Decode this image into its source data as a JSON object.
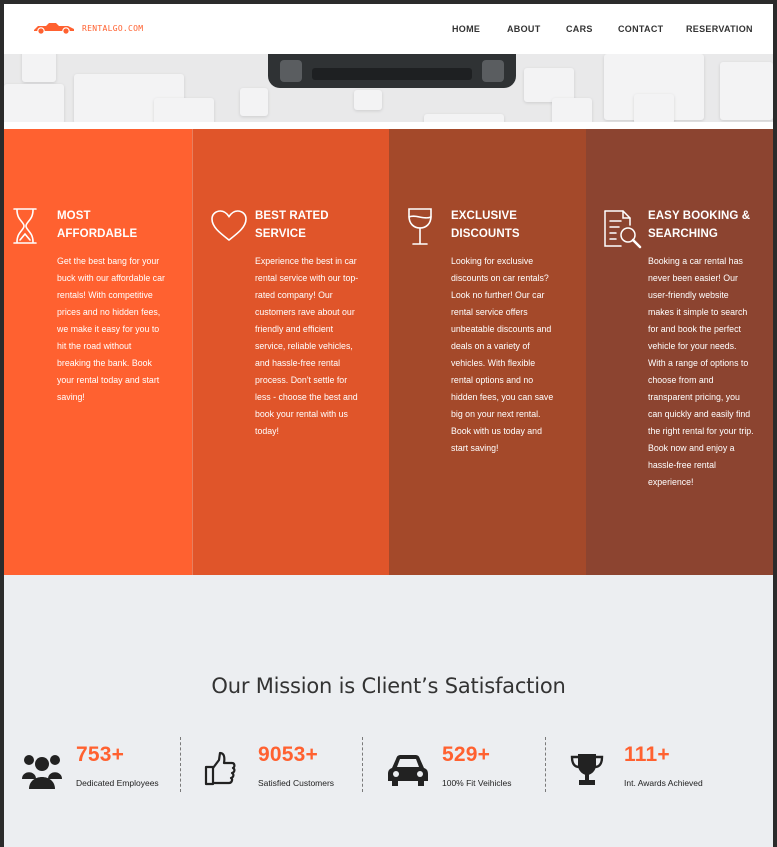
{
  "header": {
    "logo_text": "RENTALGO.COM",
    "nav": [
      "HOME",
      "ABOUT",
      "CARS",
      "CONTACT",
      "RESERVATION"
    ]
  },
  "features": [
    {
      "icon": "hourglass-icon",
      "title_line1": "MOST",
      "title_line2": "AFFORDABLE",
      "text": "Get the best bang for your buck with our affordable car rentals! With competitive prices and no hidden fees, we make it easy for you to hit the road without breaking the bank. Book your rental today and start saving!"
    },
    {
      "icon": "heart-icon",
      "title_line1": "BEST RATED",
      "title_line2": "SERVICE",
      "text": "Experience the best in car rental service with our top-rated company! Our customers rave about our friendly and efficient service, reliable vehicles, and hassle-free rental process. Don't settle for less - choose the best and book your rental with us today!"
    },
    {
      "icon": "wine-glass-icon",
      "title_line1": "EXCLUSIVE",
      "title_line2": "DISCOUNTS",
      "text": "Looking for exclusive discounts on car rentals? Look no further! Our car rental service offers unbeatable discounts and deals on a variety of vehicles. With flexible rental options and no hidden fees, you can save big on your next rental. Book with us today and start saving!"
    },
    {
      "icon": "document-search-icon",
      "title_line1": "EASY BOOKING &",
      "title_line2": "SEARCHING",
      "text": "Booking a car rental has never been easier! Our user-friendly website makes it simple to search for and book the perfect vehicle for your needs. With a range of options to choose from and transparent pricing, you can quickly and easily find the right rental for your trip. Book now and enjoy a hassle-free rental experience!"
    }
  ],
  "mission": {
    "title": "Our Mission is Client’s Satisfaction",
    "stats": [
      {
        "icon": "users-icon",
        "value": "753+",
        "label": "Dedicated Employees"
      },
      {
        "icon": "thumbs-up-icon",
        "value": "9053+",
        "label": "Satisfied Customers"
      },
      {
        "icon": "car-icon",
        "value": "529+",
        "label": "100% Fit Veihicles"
      },
      {
        "icon": "trophy-icon",
        "value": "111+",
        "label": "Int. Awards Achieved"
      }
    ]
  },
  "colors": {
    "accent": "#ff6130",
    "feature_bg": [
      "#ff6130",
      "#e0552a",
      "#a4492a",
      "#8c4430"
    ],
    "page_bg": "#eceef1"
  }
}
